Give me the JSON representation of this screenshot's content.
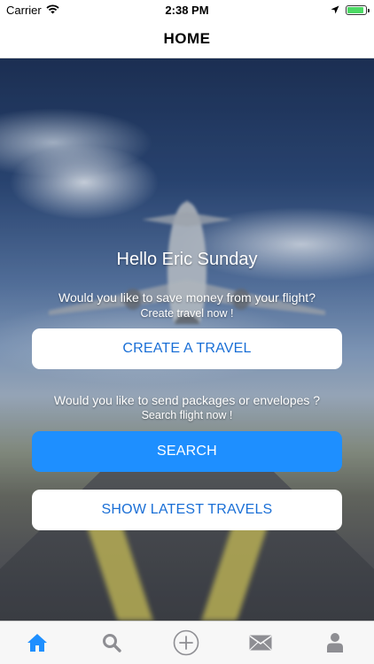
{
  "status_bar": {
    "carrier": "Carrier",
    "time": "2:38 PM",
    "battery_level": 0.9
  },
  "nav": {
    "title": "HOME"
  },
  "main": {
    "greeting": "Hello Eric Sunday",
    "create_prompt": "Would you like to save money from your flight?",
    "create_cta_hint": "Create travel now !",
    "create_button": "CREATE A TRAVEL",
    "send_prompt": "Would you like to send packages or envelopes ?",
    "search_cta_hint": "Search flight now !",
    "search_button": "SEARCH",
    "latest_button": "SHOW LATEST TRAVELS"
  },
  "tab_bar": {
    "items": [
      {
        "icon": "home-icon",
        "active": true
      },
      {
        "icon": "search-icon",
        "active": false
      },
      {
        "icon": "add-circle-icon",
        "active": false
      },
      {
        "icon": "mail-icon",
        "active": false
      },
      {
        "icon": "profile-icon",
        "active": false
      }
    ]
  },
  "colors": {
    "accent": "#1e8fff",
    "link_blue": "#1a6fd6",
    "tab_active": "#1e8fff",
    "tab_inactive": "#8e8e93"
  }
}
